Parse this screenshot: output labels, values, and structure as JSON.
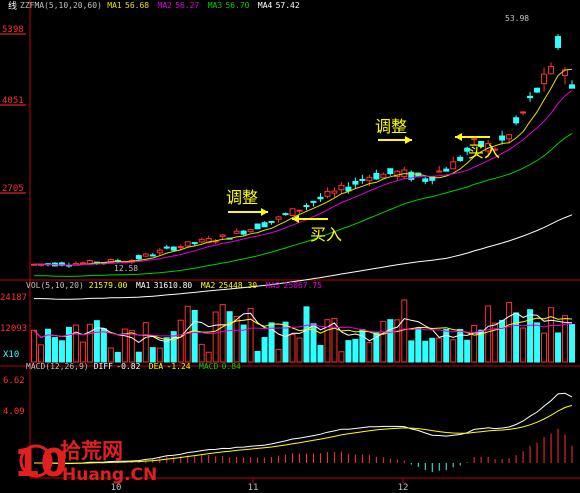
{
  "chart_data": [
    {
      "type": "candlestick",
      "panel": "price",
      "header": {
        "label": "ZZFMA(5,10,20,60)",
        "items": [
          {
            "name": "MA1",
            "value": "56.68",
            "color": "#e0e000"
          },
          {
            "name": "MA2",
            "value": "56.27",
            "color": "#e000e0"
          },
          {
            "name": "MA3",
            "value": "56.70",
            "color": "#00d000"
          },
          {
            "name": "MA4",
            "value": "57.42",
            "color": "#ffffff"
          }
        ]
      },
      "top_right_label": "线",
      "y_ticks": [
        "5398",
        "4051",
        "2705"
      ],
      "max_label": "53.98",
      "min_label": "12.58",
      "annotations": [
        {
          "text": "调整",
          "arrow": "right",
          "color": "#ffff00"
        },
        {
          "text": "买入",
          "arrow": "left",
          "color": "#ffff00"
        },
        {
          "text": "调整",
          "arrow": "right",
          "color": "#ffff00"
        },
        {
          "text": "买入",
          "arrow": "left",
          "color": "#ffff00"
        }
      ],
      "ylim": [
        9.5,
        56
      ]
    },
    {
      "type": "bar",
      "panel": "volume",
      "header": {
        "label": "VOL(5,10,20)",
        "items": [
          {
            "name": "",
            "value": "21579.00",
            "color": "#ffff00"
          },
          {
            "name": "MA1",
            "value": "31610.80",
            "color": "#ffffff"
          },
          {
            "name": "MA2",
            "value": "25448.30",
            "color": "#ffff00"
          },
          {
            "name": "MA3",
            "value": "25067.75",
            "color": "#e000e0"
          }
        ]
      },
      "y_ticks": [
        "24187",
        "12093"
      ],
      "unit_label": "X10"
    },
    {
      "type": "line",
      "panel": "macd",
      "header": {
        "label": "MACD(12,26,9)",
        "items": [
          {
            "name": "DIFF",
            "value": "-0.82",
            "color": "#ffffff"
          },
          {
            "name": "DEA",
            "value": "-1.24",
            "color": "#ffff00"
          },
          {
            "name": "MACD",
            "value": "0.84",
            "color": "#00d000"
          }
        ]
      },
      "y_ticks": [
        "6.62",
        "4.09"
      ]
    }
  ],
  "x_axis": {
    "labels": [
      "10",
      "11",
      "12"
    ]
  },
  "watermark": {
    "brand_cn": "拾荒网",
    "brand_en": "Huang.CN",
    "logo": "10"
  },
  "colors": {
    "up": "#ff3030",
    "down": "#30ffff",
    "ma1": "#e0e000",
    "ma2": "#e000e0",
    "ma3": "#00d000",
    "ma4": "#ffffff",
    "axis": "#c00000",
    "watermark": "#e02020"
  }
}
